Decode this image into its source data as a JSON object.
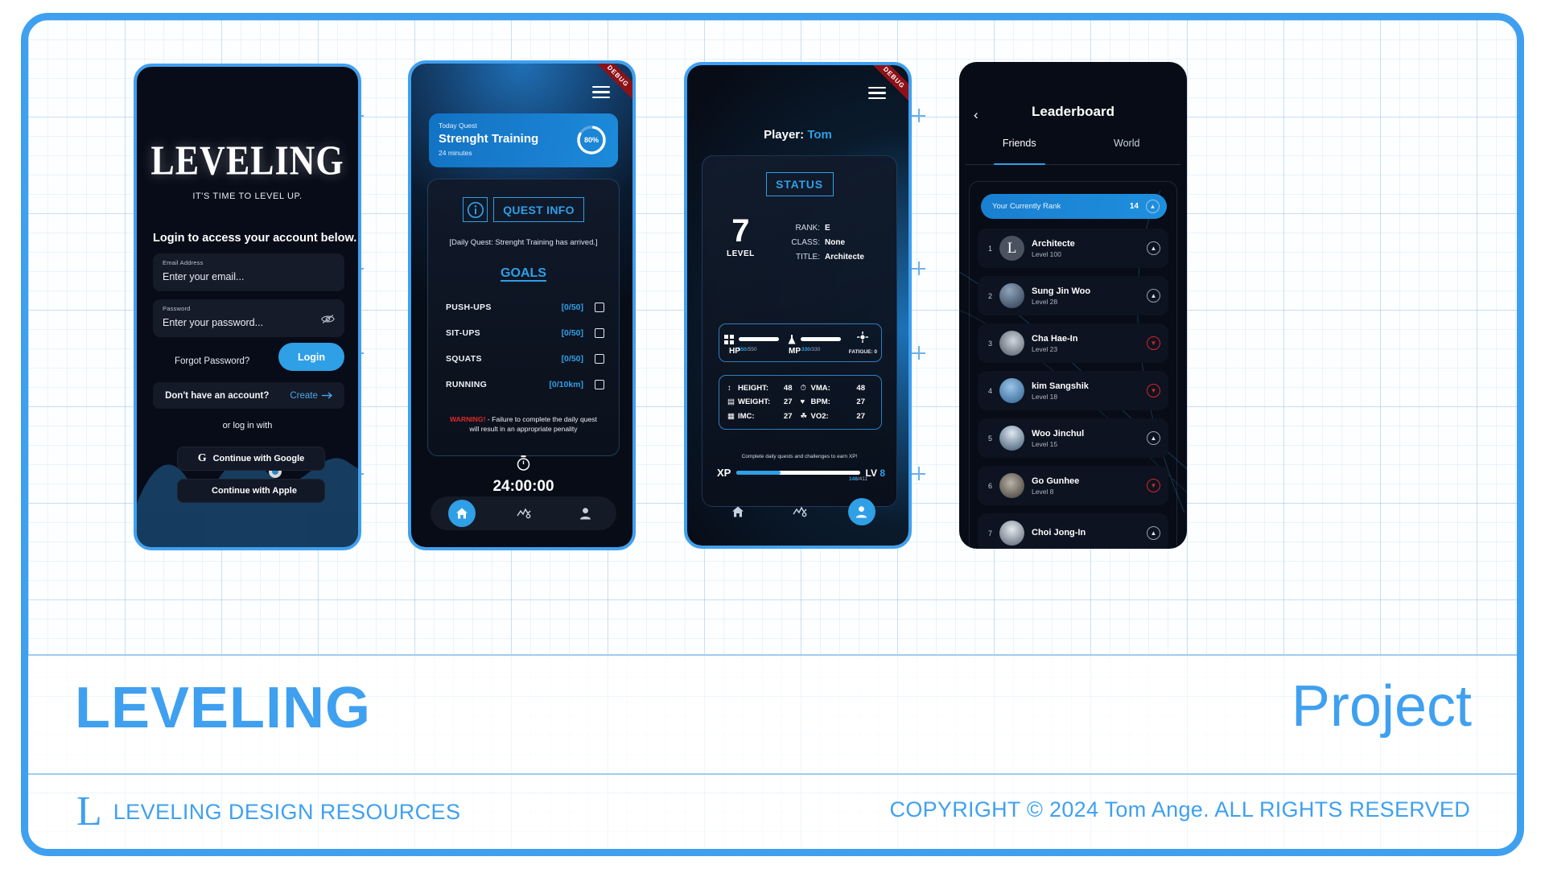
{
  "footer": {
    "brand": "LEVELING",
    "right_word": "Project",
    "logo_mark": "L",
    "left_caption": "LEVELING DESIGN RESOURCES",
    "right_caption": "COPYRIGHT © 2024 Tom Ange. ALL RIGHTS RESERVED",
    "accent": "#3fa0f0"
  },
  "login": {
    "logo": "LEVELING",
    "tagline": "IT'S TIME TO LEVEL UP.",
    "heading": "Login to access your account below.",
    "email": {
      "label": "Email Address",
      "placeholder": "Enter your email..."
    },
    "password": {
      "label": "Password",
      "placeholder": "Enter your password..."
    },
    "forgot_label": "Forgot Password?",
    "login_label": "Login",
    "no_account_label": "Don't have an account?",
    "create_label": "Create",
    "or_label": "or log in with",
    "google_label": "Continue with Google",
    "apple_label": "Continue with Apple"
  },
  "quest": {
    "debug_ribbon": "DEBUG",
    "card": {
      "eyebrow": "Today Quest",
      "title": "Strenght Training",
      "duration": "24 minutes",
      "progress_pct": 80,
      "progress_label": "80%"
    },
    "info_title": "QUEST INFO",
    "description": "[Daily Quest: Strenght Training has arrived.]",
    "goals_title": "GOALS",
    "goals": [
      {
        "name": "PUSH-UPS",
        "value": "[0/50]"
      },
      {
        "name": "SIT-UPS",
        "value": "[0/50]"
      },
      {
        "name": "SQUATS",
        "value": "[0/50]"
      },
      {
        "name": "RUNNING",
        "value": "[0/10km]"
      }
    ],
    "warning_word": "WARNING!",
    "warning_text": " - Failure to complete the daily quest will result in an appropriate penality",
    "timer": "24:00:00"
  },
  "status": {
    "debug_ribbon": "DEBUG",
    "player_prefix": "Player:",
    "player_name": "Tom",
    "badge": "STATUS",
    "level_value": "7",
    "level_caption": "LEVEL",
    "meta": [
      {
        "key": "RANK:",
        "value": "E"
      },
      {
        "key": "CLASS:",
        "value": "None"
      },
      {
        "key": "TITLE:",
        "value": "Architecte"
      }
    ],
    "hp": {
      "key": "HP",
      "current": "550",
      "max": "/550"
    },
    "mp": {
      "key": "MP",
      "current": "330",
      "max": "/330"
    },
    "fatigue_label": "FATIGUE: 0",
    "stats": [
      {
        "key": "HEIGHT:",
        "value": "48"
      },
      {
        "key": "VMA:",
        "value": "48"
      },
      {
        "key": "WEIGHT:",
        "value": "27"
      },
      {
        "key": "BPM:",
        "value": "27"
      },
      {
        "key": "IMC:",
        "value": "27"
      },
      {
        "key": "VO2:",
        "value": "27"
      }
    ],
    "xp_note": "Complete daily quests and challenges to earn XP!",
    "xp_key": "XP",
    "xp_current": "148",
    "xp_max": "/411",
    "lv_key": "LV",
    "lv_value": "8"
  },
  "leaderboard": {
    "back_icon": "‹",
    "title": "Leaderboard",
    "tabs": [
      {
        "label": "Friends",
        "active": true
      },
      {
        "label": "World",
        "active": false
      }
    ],
    "my_rank": {
      "label": "Your Currently Rank",
      "value": "14",
      "trend": "up"
    },
    "rows": [
      {
        "rank": "1",
        "name": "Architecte",
        "level": "Level 100",
        "trend": "up",
        "avatar_letter": "L"
      },
      {
        "rank": "2",
        "name": "Sung Jin Woo",
        "level": "Level 28",
        "trend": "up",
        "avatar_letter": ""
      },
      {
        "rank": "3",
        "name": "Cha Hae-In",
        "level": "Level 23",
        "trend": "down",
        "avatar_letter": ""
      },
      {
        "rank": "4",
        "name": "kim Sangshik",
        "level": "Level 18",
        "trend": "down",
        "avatar_letter": ""
      },
      {
        "rank": "5",
        "name": "Woo Jinchul",
        "level": "Level 15",
        "trend": "up",
        "avatar_letter": ""
      },
      {
        "rank": "6",
        "name": "Go  Gunhee",
        "level": "Level 8",
        "trend": "down",
        "avatar_letter": ""
      },
      {
        "rank": "7",
        "name": "Choi Jong-In",
        "level": "",
        "trend": "up",
        "avatar_letter": ""
      }
    ]
  }
}
